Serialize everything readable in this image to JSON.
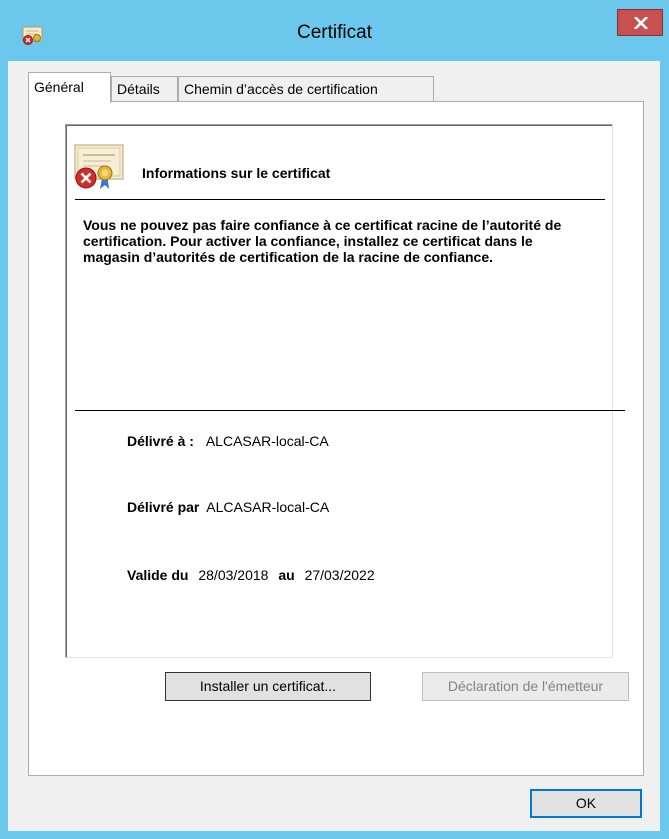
{
  "window": {
    "title": "Certificat",
    "close_label": "x"
  },
  "tabs": [
    {
      "label": "Général",
      "active": true
    },
    {
      "label": "Détails",
      "active": false
    },
    {
      "label": "Chemin d’accès de certification",
      "active": false
    }
  ],
  "general": {
    "info_heading": "Informations sur le certificat",
    "message": "Vous ne pouvez pas faire confiance à ce certificat racine de l’autorité de certification. Pour activer la confiance, installez ce certificat dans le magasin d’autorités de certification de la racine de confiance.",
    "issued_to_label": "Délivré à :",
    "issued_to_value": "ALCASAR-local-CA",
    "issued_by_label": "Délivré par",
    "issued_by_value": "ALCASAR-local-CA",
    "valid_from_label": "Valide du",
    "valid_from_value": "28/03/2018",
    "valid_to_label": "au",
    "valid_to_value": "27/03/2022"
  },
  "buttons": {
    "install_label": "Installer un certificat...",
    "issuer_statement_label": "Déclaration de l'émetteur",
    "ok_label": "OK"
  },
  "colors": {
    "title_bar": "#6cc7ec",
    "close_button": "#c75050",
    "ok_focus": "#0078d7"
  }
}
